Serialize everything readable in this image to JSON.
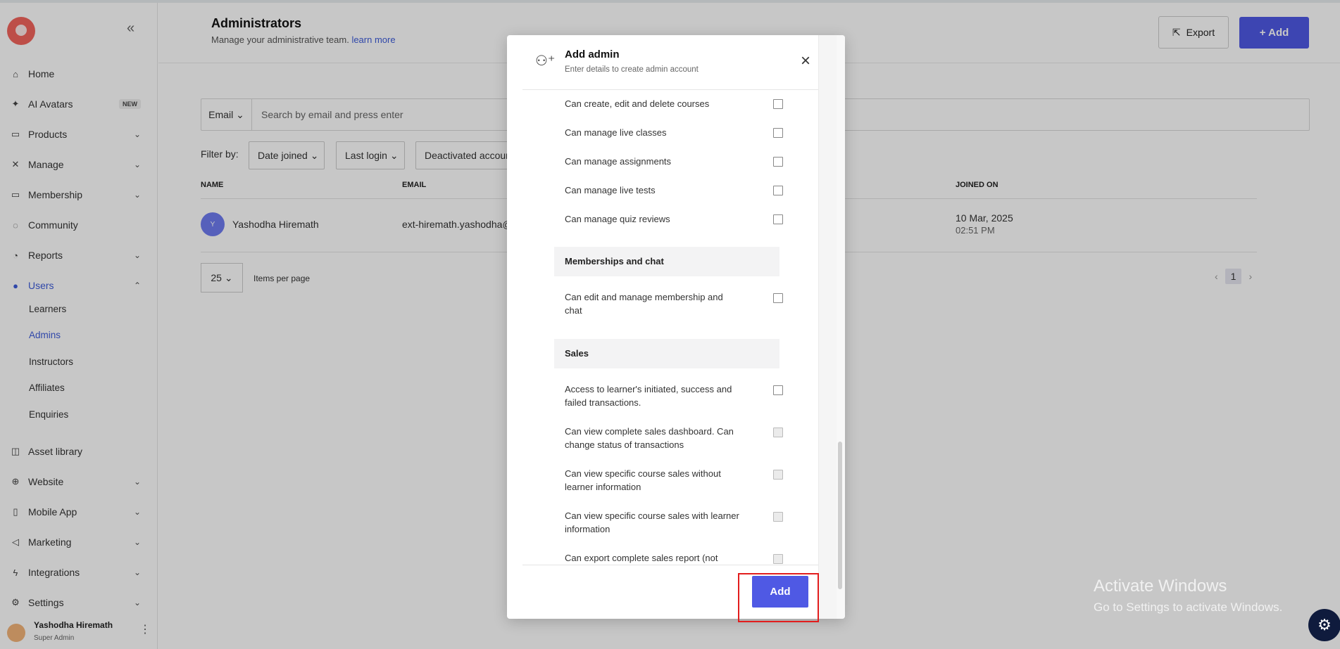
{
  "sidebar": {
    "collapse_label": "«",
    "nav": [
      {
        "label": "Home",
        "icon": "home-icon",
        "glyph": "⌂"
      },
      {
        "label": "AI Avatars",
        "icon": "sparkle-icon",
        "glyph": "✦",
        "badge": "NEW"
      },
      {
        "label": "Products",
        "icon": "box-icon",
        "glyph": "▭",
        "chev": "⌄"
      },
      {
        "label": "Manage",
        "icon": "tools-icon",
        "glyph": "✕",
        "chev": "⌄"
      },
      {
        "label": "Membership",
        "icon": "card-icon",
        "glyph": "▭",
        "chev": "⌄"
      },
      {
        "label": "Community",
        "icon": "chat-icon",
        "glyph": "◌"
      },
      {
        "label": "Reports",
        "icon": "pie-chart-icon",
        "glyph": "◔",
        "chev": "⌄"
      },
      {
        "label": "Users",
        "icon": "user-icon",
        "glyph": "●",
        "chev": "⌃"
      }
    ],
    "sub": [
      "Learners",
      "Admins",
      "Instructors",
      "Affiliates",
      "Enquiries"
    ],
    "nav2": [
      {
        "label": "Asset library",
        "icon": "book-icon",
        "glyph": "◫"
      },
      {
        "label": "Website",
        "icon": "globe-icon",
        "glyph": "⊕",
        "chev": "⌄"
      },
      {
        "label": "Mobile App",
        "icon": "phone-icon",
        "glyph": "▯",
        "chev": "⌄"
      },
      {
        "label": "Marketing",
        "icon": "megaphone-icon",
        "glyph": "◁",
        "chev": "⌄"
      },
      {
        "label": "Integrations",
        "icon": "bolt-icon",
        "glyph": "ϟ",
        "chev": "⌄"
      },
      {
        "label": "Settings",
        "icon": "gear-icon",
        "glyph": "⚙",
        "chev": "⌄"
      }
    ],
    "user": {
      "name": "Yashodha Hiremath",
      "role": "Super Admin",
      "more": "⋮"
    }
  },
  "header": {
    "title": "Administrators",
    "subtitle": "Manage your administrative team.",
    "learn_more": "learn more",
    "export_label": "Export",
    "add_label": "+ Add"
  },
  "search": {
    "type": "Email ⌄",
    "placeholder": "Search by email and press enter"
  },
  "filters": {
    "label": "Filter by:",
    "items": [
      "Date joined ⌄",
      "Last login ⌄",
      "Deactivated accounts"
    ]
  },
  "table": {
    "headers": {
      "name": "NAME",
      "email": "EMAIL",
      "joined": "JOINED ON"
    },
    "row": {
      "initial": "Y",
      "name": "Yashodha Hiremath",
      "email": "ext-hiremath.yashodha@c",
      "joined_date": "10 Mar, 2025",
      "joined_time": "02:51 PM"
    }
  },
  "pagination": {
    "per_page": "25 ⌄",
    "per_page_label": "Items per page",
    "prev": "‹",
    "current": "1",
    "next": "›"
  },
  "modal": {
    "title": "Add admin",
    "subtitle": "Enter details to create admin account",
    "close": "×",
    "perms_top": [
      "Can create, edit and delete courses",
      "Can manage live classes",
      "Can manage assignments",
      "Can manage live tests",
      "Can manage quiz reviews"
    ],
    "section_membership": "Memberships and chat",
    "perm_membership": "Can edit and manage membership and chat",
    "section_sales": "Sales",
    "perms_sales": [
      "Access to learner's initiated, success and failed transactions.",
      "Can view complete sales dashboard. Can change status of transactions",
      "Can view specific course sales without learner information",
      "Can view specific course sales with learner information",
      "Can export complete sales report (not"
    ],
    "add_label": "Add"
  },
  "watermark": {
    "line1": "Activate Windows",
    "line2": "Go to Settings to activate Windows."
  },
  "help_fab": "⚙"
}
